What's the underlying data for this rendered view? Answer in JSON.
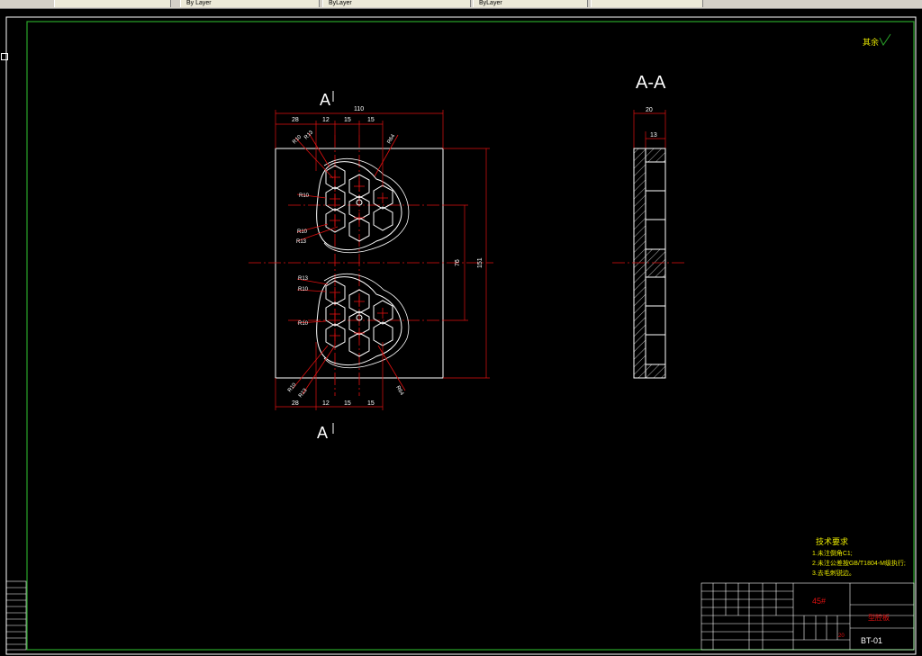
{
  "tabs": [
    {
      "label": ""
    },
    {
      "label": "By Layer"
    },
    {
      "label": "ByLayer"
    },
    {
      "label": "ByLayer"
    },
    {
      "label": ""
    }
  ],
  "drawing": {
    "section_label_top": "A",
    "section_label_bottom": "A",
    "section_view_title": "A-A",
    "roughness_note": "其余",
    "dims_top": {
      "overall": "110",
      "d1": "28",
      "d2": "12",
      "d3": "15",
      "d4": "15"
    },
    "dims_bottom": {
      "d1": "28",
      "d2": "12",
      "d3": "15",
      "d4": "15"
    },
    "dims_right": {
      "inner": "76",
      "outer": "151"
    },
    "dims_section": {
      "outer": "20",
      "inner": "13"
    },
    "radii_top": [
      "R10",
      "R13",
      "R10",
      "R10",
      "R13",
      "R64"
    ],
    "radii_bottom": [
      "R13",
      "R10",
      "R10",
      "R10",
      "R13",
      "R64"
    ]
  },
  "tech_req": {
    "title": "技术要求",
    "lines": [
      "1.未注倒角C1;",
      "2.未注公差按GB/T1804-M级执行;",
      "3.去毛刺锐边。"
    ]
  },
  "title_block": {
    "material": "45#",
    "part_name": "型腔板",
    "drawing_no": "BT-01",
    "scale": "20"
  }
}
